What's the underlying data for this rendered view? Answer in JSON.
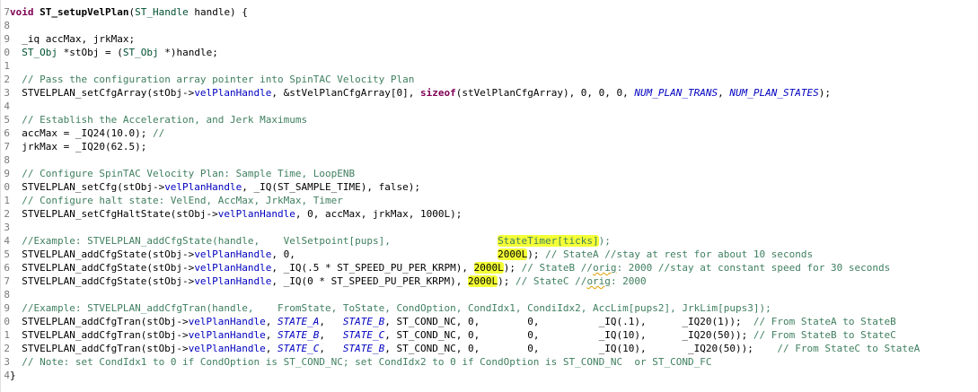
{
  "editor": {
    "colors": {
      "keyword": "#7f0055",
      "comment": "#3f7f5f",
      "macro": "#0000c0",
      "type": "#005032",
      "highlight": "#f4ff36"
    },
    "lines": [
      {
        "num": "7",
        "segs": [
          {
            "t": "void",
            "c": "kw"
          },
          {
            "t": " "
          },
          {
            "t": "ST_setupVelPlan",
            "c": "fn"
          },
          {
            "t": "("
          },
          {
            "t": "ST_Handle",
            "c": "ty"
          },
          {
            "t": " handle) {"
          }
        ]
      },
      {
        "num": "8",
        "segs": [
          {
            "t": ""
          }
        ]
      },
      {
        "num": "9",
        "segs": [
          {
            "t": "  _iq accMax, jrkMax;"
          }
        ]
      },
      {
        "num": "0",
        "segs": [
          {
            "t": "  "
          },
          {
            "t": "ST_Obj",
            "c": "ty"
          },
          {
            "t": " *stObj = ("
          },
          {
            "t": "ST_Obj",
            "c": "ty"
          },
          {
            "t": " *)handle;"
          }
        ]
      },
      {
        "num": "1",
        "segs": [
          {
            "t": ""
          }
        ]
      },
      {
        "num": "2",
        "segs": [
          {
            "t": "  "
          },
          {
            "t": "// Pass the configuration array pointer into SpinTAC Velocity Plan",
            "c": "cm"
          }
        ]
      },
      {
        "num": "3",
        "segs": [
          {
            "t": "  STVELPLAN_setCfgArray(stObj->"
          },
          {
            "t": "velPlanHandle",
            "c": "fld"
          },
          {
            "t": ", &stVelPlanCfgArray[0], "
          },
          {
            "t": "sizeof",
            "c": "kw"
          },
          {
            "t": "(stVelPlanCfgArray), 0, 0, 0, "
          },
          {
            "t": "NUM_PLAN_TRANS",
            "c": "mac"
          },
          {
            "t": ", "
          },
          {
            "t": "NUM_PLAN_STATES",
            "c": "mac"
          },
          {
            "t": ");"
          }
        ]
      },
      {
        "num": "4",
        "segs": [
          {
            "t": ""
          }
        ]
      },
      {
        "num": "5",
        "segs": [
          {
            "t": "  "
          },
          {
            "t": "// Establish the Acceleration, and Jerk Maximums",
            "c": "cm"
          }
        ]
      },
      {
        "num": "6",
        "segs": [
          {
            "t": "  accMax = _IQ24(10.0); "
          },
          {
            "t": "//",
            "c": "cm"
          }
        ]
      },
      {
        "num": "7",
        "segs": [
          {
            "t": "  jrkMax = _IQ20(62.5);"
          }
        ]
      },
      {
        "num": "8",
        "segs": [
          {
            "t": ""
          }
        ]
      },
      {
        "num": "9",
        "segs": [
          {
            "t": "  "
          },
          {
            "t": "// Configure SpinTAC Velocity Plan: Sample Time, LoopENB",
            "c": "cm"
          }
        ]
      },
      {
        "num": "0",
        "segs": [
          {
            "t": "  STVELPLAN_setCfg(stObj->"
          },
          {
            "t": "velPlanHandle",
            "c": "fld"
          },
          {
            "t": ", _IQ(ST_SAMPLE_TIME), false);"
          }
        ]
      },
      {
        "num": "1",
        "segs": [
          {
            "t": "  "
          },
          {
            "t": "// Configure halt state: VelEnd, AccMax, JrkMax, Timer",
            "c": "cm"
          }
        ]
      },
      {
        "num": "2",
        "segs": [
          {
            "t": "  STVELPLAN_setCfgHaltState(stObj->"
          },
          {
            "t": "velPlanHandle",
            "c": "fld"
          },
          {
            "t": ", 0, accMax, jrkMax, 1000L);"
          }
        ]
      },
      {
        "num": "3",
        "segs": [
          {
            "t": ""
          }
        ]
      },
      {
        "num": "4",
        "segs": [
          {
            "t": "  "
          },
          {
            "t": "//Example: STVELPLAN_addCfgState(handle,    VelSetpoint[pups],                  ",
            "c": "cm"
          },
          {
            "t": "StateTimer[ticks]",
            "c": "cm hl"
          },
          {
            "t": ");",
            "c": "cm"
          }
        ]
      },
      {
        "num": "5",
        "segs": [
          {
            "t": "  STVELPLAN_addCfgState(stObj->"
          },
          {
            "t": "velPlanHandle",
            "c": "fld"
          },
          {
            "t": ", 0,                                  "
          },
          {
            "t": "2000L",
            "c": "hl"
          },
          {
            "t": "); "
          },
          {
            "t": "// StateA //stay at rest for about 10 seconds",
            "c": "cm"
          }
        ]
      },
      {
        "num": "6",
        "segs": [
          {
            "t": "  STVELPLAN_addCfgState(stObj->"
          },
          {
            "t": "velPlanHandle",
            "c": "fld"
          },
          {
            "t": ", _IQ(.5 * ST_SPEED_PU_PER_KRPM), "
          },
          {
            "t": "2000L",
            "c": "hl"
          },
          {
            "t": "); "
          },
          {
            "t": "// StateB //",
            "c": "cm"
          },
          {
            "t": "orig",
            "c": "cm orig"
          },
          {
            "t": ": 2000 //stay at constant speed for 30 seconds",
            "c": "cm"
          }
        ]
      },
      {
        "num": "7",
        "segs": [
          {
            "t": "  STVELPLAN_addCfgState(stObj->"
          },
          {
            "t": "velPlanHandle",
            "c": "fld"
          },
          {
            "t": ", _IQ(0 * ST_SPEED_PU_PER_KRPM), "
          },
          {
            "t": "2000L",
            "c": "hl"
          },
          {
            "t": "); "
          },
          {
            "t": "// StateC //",
            "c": "cm"
          },
          {
            "t": "orig",
            "c": "cm orig"
          },
          {
            "t": ": 2000",
            "c": "cm"
          }
        ]
      },
      {
        "num": "8",
        "segs": [
          {
            "t": ""
          }
        ]
      },
      {
        "num": "9",
        "segs": [
          {
            "t": "  "
          },
          {
            "t": "//Example: STVELPLAN_addCfgTran(handle,    FromState, ToState, CondOption, CondIdx1, CondiIdx2, AccLim[pups2], JrkLim[pups3]);",
            "c": "cm"
          }
        ]
      },
      {
        "num": "0",
        "segs": [
          {
            "t": "  STVELPLAN_addCfgTran(stObj->"
          },
          {
            "t": "velPlanHandle",
            "c": "fld"
          },
          {
            "t": ", "
          },
          {
            "t": "STATE_A",
            "c": "mac"
          },
          {
            "t": ",   "
          },
          {
            "t": "STATE_B",
            "c": "mac"
          },
          {
            "t": ", ST_COND_NC, 0,        0,          _IQ(.1),      _IQ20(1));  "
          },
          {
            "t": "// From StateA to StateB",
            "c": "cm"
          }
        ]
      },
      {
        "num": "1",
        "segs": [
          {
            "t": "  STVELPLAN_addCfgTran(stObj->"
          },
          {
            "t": "velPlanHandle",
            "c": "fld"
          },
          {
            "t": ", "
          },
          {
            "t": "STATE_B",
            "c": "mac"
          },
          {
            "t": ",   "
          },
          {
            "t": "STATE_C",
            "c": "mac"
          },
          {
            "t": ", ST_COND_NC, 0,        0,          _IQ(10),      _IQ20(50)); "
          },
          {
            "t": "// From StateB to StateC",
            "c": "cm"
          }
        ]
      },
      {
        "num": "2",
        "segs": [
          {
            "t": "  STVELPLAN_addCfgTran(stObj->"
          },
          {
            "t": "velPlanHandle",
            "c": "fld"
          },
          {
            "t": ", "
          },
          {
            "t": "STATE_C",
            "c": "mac"
          },
          {
            "t": ",   "
          },
          {
            "t": "STATE_B",
            "c": "mac"
          },
          {
            "t": ", ST_COND_NC, 0,        0,          _IQ(10),       _IQ20(50));    "
          },
          {
            "t": "// From StateC to StateA",
            "c": "cm"
          }
        ]
      },
      {
        "num": "3",
        "segs": [
          {
            "t": "  "
          },
          {
            "t": "// Note: set CondIdx1 to 0 if CondOption is ST_COND_NC; set CondIdx2 to 0 if CondOption is ST_COND_NC  or ST_COND_FC",
            "c": "cm"
          }
        ]
      },
      {
        "num": "4",
        "segs": [
          {
            "t": "}"
          }
        ]
      }
    ]
  }
}
